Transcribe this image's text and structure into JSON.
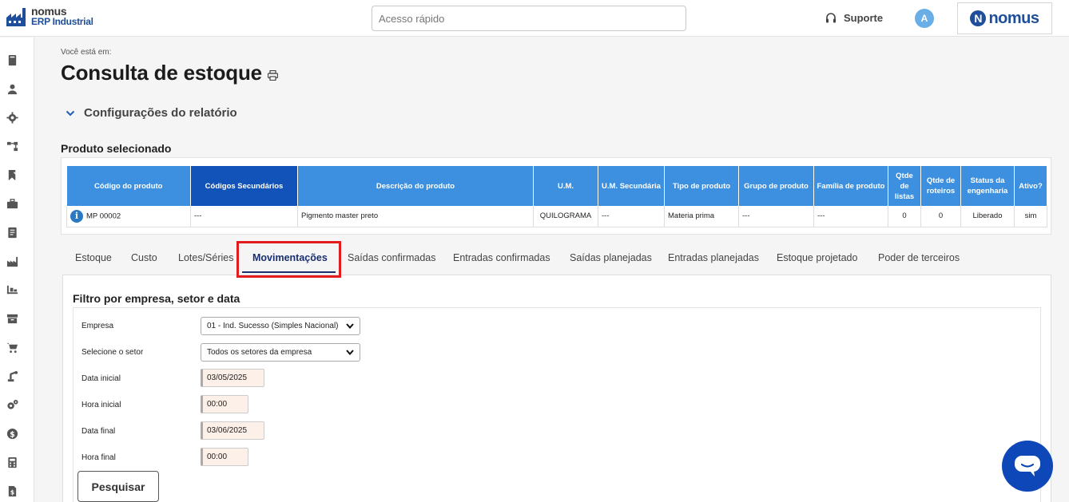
{
  "brand": {
    "line1": "nomus",
    "line2": "ERP Industrial"
  },
  "header": {
    "quick_search_placeholder": "Acesso rápido",
    "support_label": "Suporte",
    "avatar_letter": "A",
    "logo_letter": "N",
    "logo_word": "nomus"
  },
  "sidebar": {
    "icons": [
      "book-icon",
      "user-icon",
      "gear-icon",
      "hierarchy-icon",
      "bookmark-check-icon",
      "briefcase-icon",
      "document-icon",
      "factory-icon",
      "forklift-icon",
      "archive-icon",
      "cart-icon",
      "robot-arm-icon",
      "cogs-icon",
      "dollar-icon",
      "calculator-icon",
      "invoice-icon"
    ]
  },
  "page": {
    "breadcrumb": "Você está em:",
    "title": "Consulta de estoque",
    "config_label": "Configurações do relatório",
    "product_heading": "Produto selecionado"
  },
  "product_table": {
    "headers": [
      "Código do produto",
      "Códigos Secundários",
      "Descrição do produto",
      "U.M.",
      "U.M. Secundária",
      "Tipo de produto",
      "Grupo de produto",
      "Família de produto",
      "Qtde de listas",
      "Qtde de roteiros",
      "Status da engenharia",
      "Ativo?"
    ],
    "row": {
      "codigo": "MP 00002",
      "secundarios": "---",
      "descricao": "Pigmento master preto",
      "um": "QUILOGRAMA",
      "um_sec": "---",
      "tipo": "Materia prima",
      "grupo": "---",
      "familia": "---",
      "listas": "0",
      "roteiros": "0",
      "status": "Liberado",
      "ativo": "sim"
    }
  },
  "tabs": [
    "Estoque",
    "Custo",
    "Lotes/Séries",
    "Movimentações",
    "Saídas confirmadas",
    "Entradas confirmadas",
    "Saídas planejadas",
    "Entradas planejadas",
    "Estoque projetado",
    "Poder de terceiros"
  ],
  "active_tab": "Movimentações",
  "filter": {
    "title": "Filtro por empresa, setor e data",
    "empresa_label": "Empresa",
    "empresa_value": "01 - Ind. Sucesso (Simples Nacional)",
    "setor_label": "Selecione o setor",
    "setor_value": "Todos os setores da empresa",
    "data_inicial_label": "Data inicial",
    "data_inicial_value": "03/05/2025",
    "hora_inicial_label": "Hora inicial",
    "hora_inicial_value": "00:00",
    "data_final_label": "Data final",
    "data_final_value": "03/06/2025",
    "hora_final_label": "Hora final",
    "hora_final_value": "00:00",
    "search_button": "Pesquisar"
  },
  "colors": {
    "primary": "#3d8fdf",
    "primary_dark": "#1153b8",
    "highlight": "#e21c1c",
    "chat": "#0d47b8"
  }
}
